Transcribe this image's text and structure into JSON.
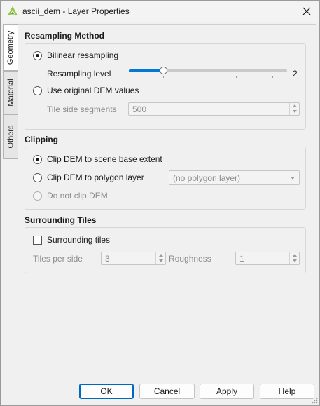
{
  "window": {
    "title": "ascii_dem - Layer Properties",
    "app_icon": "qgis-icon",
    "close_icon": "close-icon"
  },
  "tabs": [
    {
      "label": "Geometry",
      "active": true
    },
    {
      "label": "Material",
      "active": false
    },
    {
      "label": "Others",
      "active": false
    }
  ],
  "resampling": {
    "title": "Resampling Method",
    "bilinear_label": "Bilinear resampling",
    "bilinear_checked": true,
    "level_label": "Resampling level",
    "level_value": "2",
    "level_fraction": 0.22,
    "original_label": "Use original DEM values",
    "original_checked": false,
    "segments_label": "Tile side segments",
    "segments_value": "500"
  },
  "clipping": {
    "title": "Clipping",
    "scene_label": "Clip DEM to scene base extent",
    "scene_checked": true,
    "polygon_label": "Clip DEM to polygon layer",
    "polygon_layer_value": "(no polygon layer)",
    "noclip_label": "Do not clip DEM"
  },
  "surrounding": {
    "title": "Surrounding Tiles",
    "checkbox_label": "Surrounding tiles",
    "checked": false,
    "tiles_label": "Tiles per side",
    "tiles_value": "3",
    "roughness_label": "Roughness",
    "roughness_value": "1"
  },
  "buttons": {
    "ok": "OK",
    "cancel": "Cancel",
    "apply": "Apply",
    "help": "Help"
  },
  "colors": {
    "accent": "#0078d4",
    "qgis_green": "#8dc63f"
  }
}
